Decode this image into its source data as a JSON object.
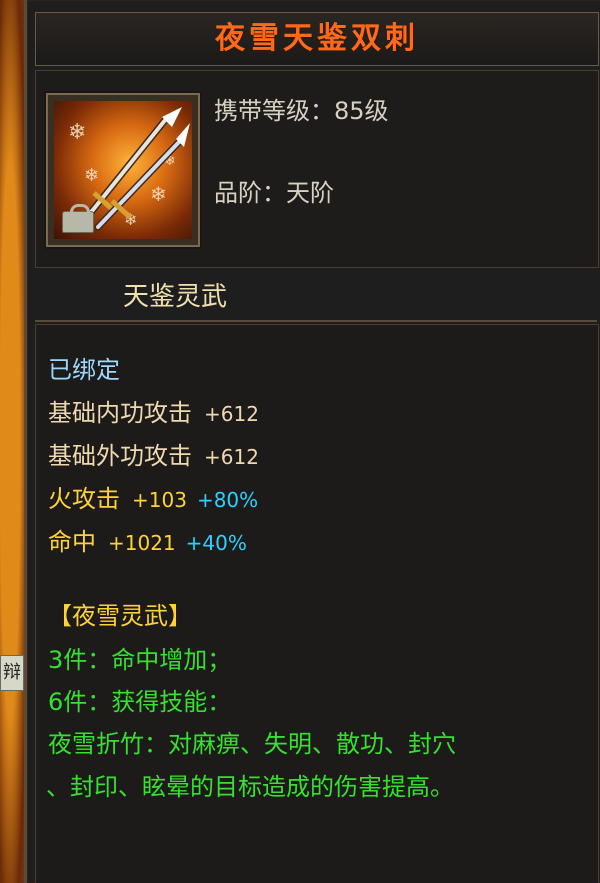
{
  "item": {
    "name": "夜雪天鉴双刺",
    "level_line": "携带等级：85级",
    "grade_line": "品阶：天阶",
    "subtitle": "天鉴灵武"
  },
  "background": {
    "tag_text": "辩"
  },
  "attributes": {
    "bound": "已绑定",
    "inner_attack_label": "基础内功攻击",
    "inner_attack_value": "+612",
    "outer_attack_label": "基础外功攻击",
    "outer_attack_value": "+612",
    "fire_label": "火攻击",
    "fire_value": "+103",
    "fire_bonus": "+80%",
    "hit_label": "命中",
    "hit_value": "+1021",
    "hit_bonus": "+40%"
  },
  "set": {
    "name": "【夜雪灵武】",
    "bonus3": "3件：命中增加；",
    "bonus6": "6件：获得技能：",
    "skill_line1": "夜雪折竹：对麻痹、失明、散功、封穴",
    "skill_line2": "、封印、眩晕的目标造成的伤害提高。"
  },
  "colors": {
    "title": "#ff6a1a",
    "bound": "#9ed8ff",
    "base_attr": "#efd9b0",
    "elemental": "#ffd23a",
    "bonus_percent": "#2fd0ff",
    "set_text": "#37e030"
  },
  "icons": {
    "item_icon": "twin-daggers-icon",
    "bind_icon": "lock-icon"
  }
}
